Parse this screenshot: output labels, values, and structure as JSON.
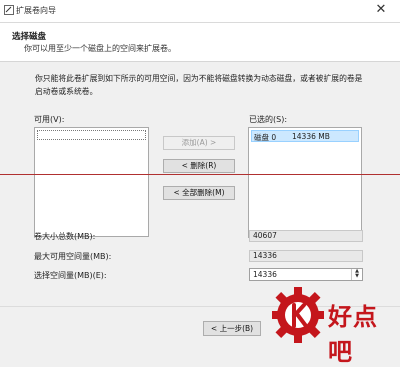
{
  "window": {
    "title": "扩展卷向导",
    "close_glyph": "✕"
  },
  "header": {
    "title": "选择磁盘",
    "subtitle": "你可以用至少一个磁盘上的空间来扩展卷。"
  },
  "description": "你只能将此卷扩展到如下所示的可用空间，因为不能将磁盘转换为动态磁盘，或者被扩展的卷是启动卷或系统卷。",
  "available": {
    "label": "可用(V):",
    "items": []
  },
  "selected": {
    "label": "已选的(S):",
    "items": [
      {
        "disk": "磁盘 0",
        "size": "14336 MB"
      }
    ]
  },
  "buttons": {
    "add": "添加(A) >",
    "remove": "< 删除(R)",
    "remove_all": "< 全部删除(M)",
    "back": "< 上一步(B)"
  },
  "fields": {
    "total_label": "卷大小总数(MB):",
    "total_value": "40607",
    "max_label": "最大可用空间量(MB):",
    "max_value": "14336",
    "select_label": "选择空间量(MB)(E):",
    "select_value": "14336"
  },
  "watermark": {
    "text": "好点吧"
  },
  "colors": {
    "selection": "#cce8ff",
    "watermark": "#c4161c",
    "divider": "#b03030"
  }
}
